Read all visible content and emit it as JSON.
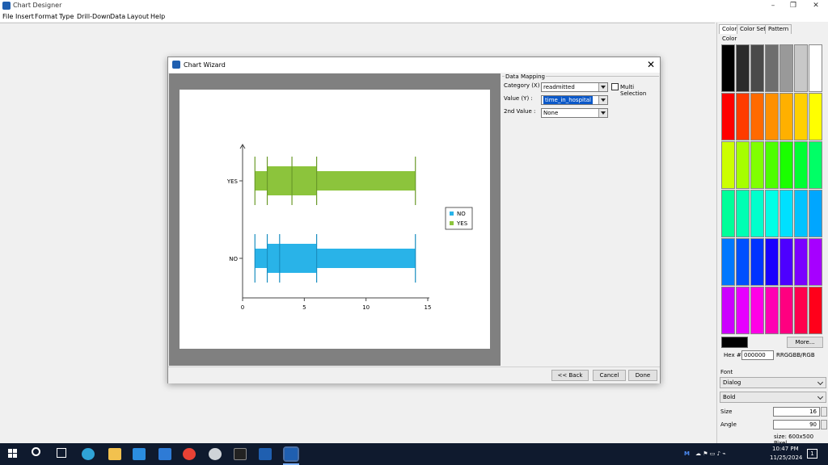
{
  "app": {
    "title": "Chart Designer",
    "controls": [
      "–",
      "❐",
      "✕"
    ],
    "menu": [
      "File",
      "Insert",
      "Format",
      "Type",
      "Drill-Down",
      "Data",
      "Layout",
      "Help"
    ]
  },
  "dialog": {
    "title": "Chart Wizard",
    "close": "✕",
    "mapping": {
      "group_title": "Data Mapping",
      "category_label": "Category (X) :",
      "category_value": "readmitted",
      "value_label": "Value (Y) :",
      "value_value": "time_in_hospital",
      "second_label": "2nd Value :",
      "second_value": "None",
      "multi_label": "Multi Selection"
    },
    "buttons": {
      "back": "<< Back",
      "cancel": "Cancel",
      "done": "Done"
    }
  },
  "chart_data": {
    "type": "boxplot",
    "orientation": "horizontal",
    "categories": [
      "NO",
      "YES"
    ],
    "series": [
      {
        "name": "NO",
        "color": "#29b3e8",
        "category": "NO",
        "min": 1,
        "q1": 2,
        "median": 3,
        "q3": 6,
        "max": 14
      },
      {
        "name": "YES",
        "color": "#8cc43c",
        "category": "YES",
        "min": 1,
        "q1": 2,
        "median": 4,
        "q3": 6,
        "max": 14
      }
    ],
    "xlim": [
      0,
      15
    ],
    "xticks": [
      "0",
      "5",
      "10",
      "15"
    ],
    "legend": {
      "placement": "right",
      "entries": [
        "NO",
        "YES"
      ]
    },
    "grid": false
  },
  "right_panel": {
    "tabs": [
      "Color",
      "Color Set",
      "Pattern"
    ],
    "color_label": "Color",
    "swatch_rows": [
      [
        "#000000",
        "#2b2b2b",
        "#4a4a4a",
        "#6e6e6e",
        "#999999",
        "#c8c8c8",
        "#ffffff"
      ],
      [
        "#ff0000",
        "#ff3b00",
        "#ff6a00",
        "#ff9000",
        "#ffb000",
        "#ffd000",
        "#ffff00"
      ],
      [
        "#ccff00",
        "#a6ff00",
        "#80ff00",
        "#4dff00",
        "#1aff00",
        "#00ff33",
        "#00ff66"
      ],
      [
        "#00ff99",
        "#00ffb3",
        "#00ffcc",
        "#00ffe6",
        "#00e0ff",
        "#00c3ff",
        "#00a6ff"
      ],
      [
        "#0077ff",
        "#0050ff",
        "#0033ff",
        "#1a00ff",
        "#4d00ff",
        "#7a00ff",
        "#a600ff"
      ],
      [
        "#cc00ff",
        "#e600ff",
        "#ff00e6",
        "#ff00b3",
        "#ff0080",
        "#ff004d",
        "#ff001a"
      ]
    ],
    "selected_color": "#000000",
    "more_button": "More...",
    "hex_label": "Hex #",
    "hex_value": "000000",
    "hex_format": "RRGGBB/RGB",
    "font_label": "Font",
    "font_value": "Dialog",
    "style_value": "Bold",
    "size_label": "Size",
    "size_value": "16",
    "angle_label": "Angle",
    "angle_value": "90",
    "status": "size: 600x500 Pixel"
  },
  "taskbar": {
    "time": "10:47 PM",
    "date": "11/25/2024",
    "notifications": "1"
  }
}
